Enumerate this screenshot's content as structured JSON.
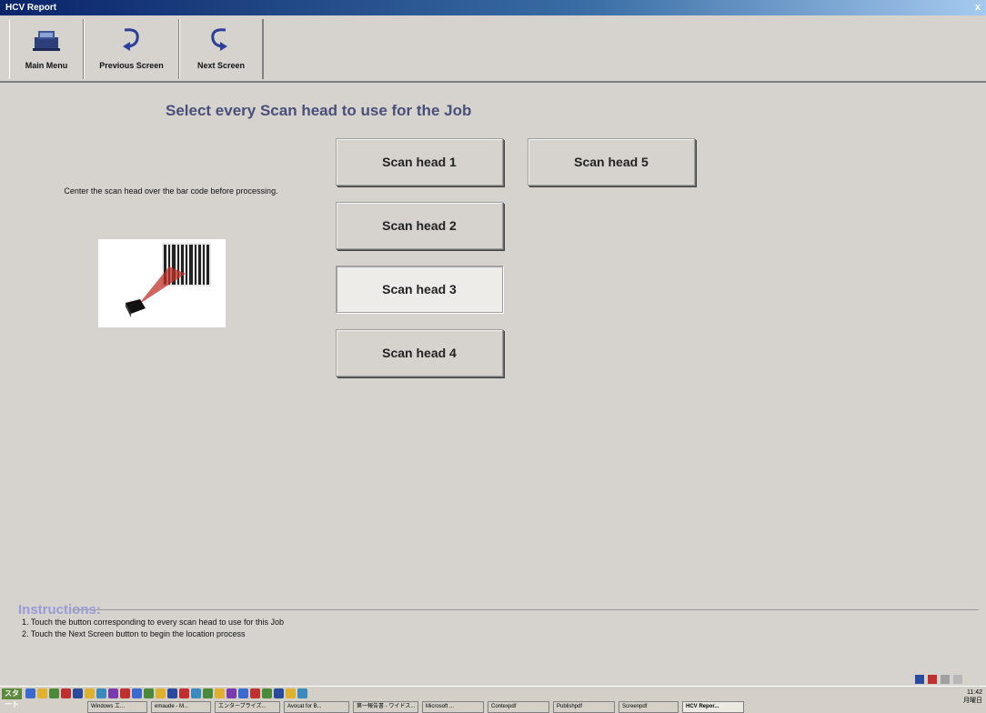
{
  "window": {
    "title": "HCV Report",
    "close_glyph": "x"
  },
  "toolbar": {
    "buttons": [
      {
        "label": "Main Menu",
        "icon": "main-menu-icon"
      },
      {
        "label": "Previous Screen",
        "icon": "previous-screen-icon"
      },
      {
        "label": "Next Screen",
        "icon": "next-screen-icon"
      }
    ]
  },
  "main": {
    "heading": "Select every Scan head to use for the Job",
    "hint": "Center the scan head over the bar code before processing.",
    "scan_heads": [
      {
        "label": "Scan head 1",
        "selected": false
      },
      {
        "label": "Scan head 2",
        "selected": false
      },
      {
        "label": "Scan head 3",
        "selected": true
      },
      {
        "label": "Scan head 4",
        "selected": false
      },
      {
        "label": "Scan head 5",
        "selected": false
      }
    ]
  },
  "instructions": {
    "title": "Instructions:",
    "line1": "1. Touch the button corresponding to every scan head to use for this Job",
    "line2": "2. Touch the Next Screen button to begin the location process"
  },
  "taskbar": {
    "start_label": "スタート",
    "tasks": [
      {
        "label": "Windows エ..."
      },
      {
        "label": "emaude - M..."
      },
      {
        "label": "エンタープライズ..."
      },
      {
        "label": "Avocat for B..."
      },
      {
        "label": "第一報告書 - ワイドス..."
      },
      {
        "label": "Microsoft ..."
      },
      {
        "label": "Contexpdf"
      },
      {
        "label": "Publishpdf"
      },
      {
        "label": "Screenpdf"
      },
      {
        "label": "HCV Repor..."
      }
    ],
    "clock_time": "11:42",
    "clock_label": "月曜日"
  },
  "colors": {
    "background": "#d6d3ce",
    "heading": "#4a4f7a",
    "instructions_title": "#9a9ad6",
    "titlebar": "#0a246a"
  }
}
